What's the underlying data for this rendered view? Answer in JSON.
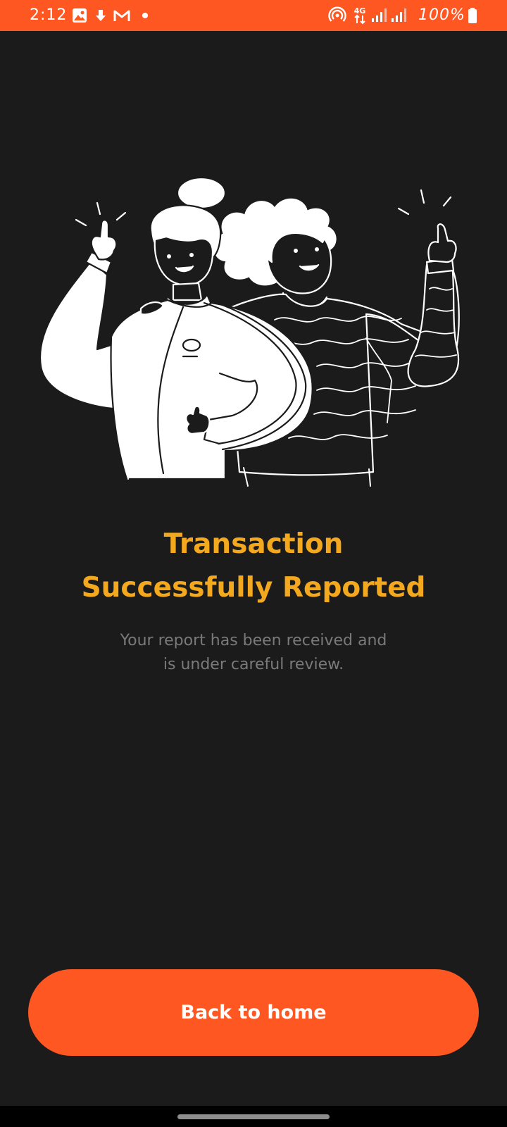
{
  "status_bar": {
    "time": "2:12",
    "battery_percent": "100%",
    "network_label": "4G",
    "icons": [
      "image-icon",
      "download-icon",
      "gmail-icon",
      "dot-icon",
      "hotspot-icon",
      "4g-icon",
      "signal-icon",
      "signal-icon",
      "battery-icon"
    ]
  },
  "main": {
    "title_line1": "Transaction",
    "title_line2": "Successfully Reported",
    "subtitle_line1": "Your report has been received and",
    "subtitle_line2": "is under careful review."
  },
  "actions": {
    "back_home_label": "Back to home"
  },
  "colors": {
    "accent": "#ff5722",
    "title": "#f4a81d",
    "background": "#1b1b1b",
    "subtitle": "#7a7a7a"
  }
}
